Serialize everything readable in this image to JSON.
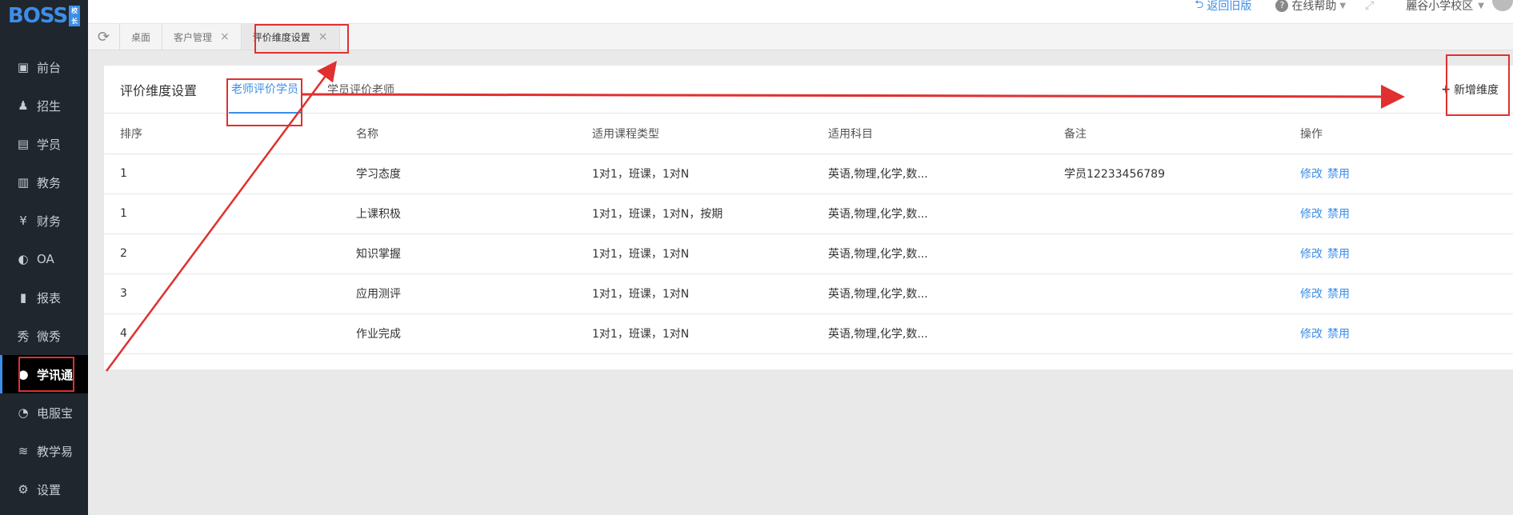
{
  "logo": {
    "text": "BOSS",
    "sub": "校长"
  },
  "sidebar": {
    "items": [
      {
        "label": "前台",
        "icon": "calendar-icon"
      },
      {
        "label": "招生",
        "icon": "user-add-icon"
      },
      {
        "label": "学员",
        "icon": "id-card-icon"
      },
      {
        "label": "教务",
        "icon": "book-icon"
      },
      {
        "label": "财务",
        "icon": "yen-coin-icon"
      },
      {
        "label": "OA",
        "icon": "toggle-icon"
      },
      {
        "label": "报表",
        "icon": "bar-chart-icon"
      },
      {
        "label": "微秀",
        "icon": "show-icon"
      },
      {
        "label": "学讯通",
        "icon": "pin-icon",
        "active": true
      },
      {
        "label": "电服宝",
        "icon": "phone-service-icon"
      },
      {
        "label": "教学易",
        "icon": "teach-icon"
      },
      {
        "label": "设置",
        "icon": "gear-icon"
      }
    ]
  },
  "topbar": {
    "back_label": "返回旧版",
    "help_label": "在线帮助",
    "campus_label": "麗谷小学校区"
  },
  "tabs": [
    {
      "label": "桌面",
      "closable": false
    },
    {
      "label": "客户管理",
      "closable": true
    },
    {
      "label": "评价维度设置",
      "closable": true,
      "active": true
    }
  ],
  "card": {
    "title": "评价维度设置",
    "subtabs": [
      {
        "label": "老师评价学员",
        "active": true
      },
      {
        "label": "学员评价老师"
      }
    ],
    "add_label": "新增维度"
  },
  "table": {
    "headers": [
      "排序",
      "名称",
      "适用课程类型",
      "适用科目",
      "备注",
      "操作"
    ],
    "rows": [
      {
        "order": "1",
        "name": "学习态度",
        "course": "1对1，班课，1对N",
        "subject": "英语,物理,化学,数...",
        "remark": "学员12233456789",
        "edit": "修改",
        "disable": "禁用"
      },
      {
        "order": "1",
        "name": "上课积极",
        "course": "1对1，班课，1对N，按期",
        "subject": "英语,物理,化学,数...",
        "remark": "",
        "edit": "修改",
        "disable": "禁用"
      },
      {
        "order": "2",
        "name": "知识掌握",
        "course": "1对1，班课，1对N",
        "subject": "英语,物理,化学,数...",
        "remark": "",
        "edit": "修改",
        "disable": "禁用"
      },
      {
        "order": "3",
        "name": "应用测评",
        "course": "1对1，班课，1对N",
        "subject": "英语,物理,化学,数...",
        "remark": "",
        "edit": "修改",
        "disable": "禁用"
      },
      {
        "order": "4",
        "name": "作业完成",
        "course": "1对1，班课，1对N",
        "subject": "英语,物理,化学,数...",
        "remark": "",
        "edit": "修改",
        "disable": "禁用"
      }
    ]
  },
  "colors": {
    "accent": "#3c8ee8",
    "sidebar_bg": "#20262e",
    "annotation": "#e03030"
  }
}
